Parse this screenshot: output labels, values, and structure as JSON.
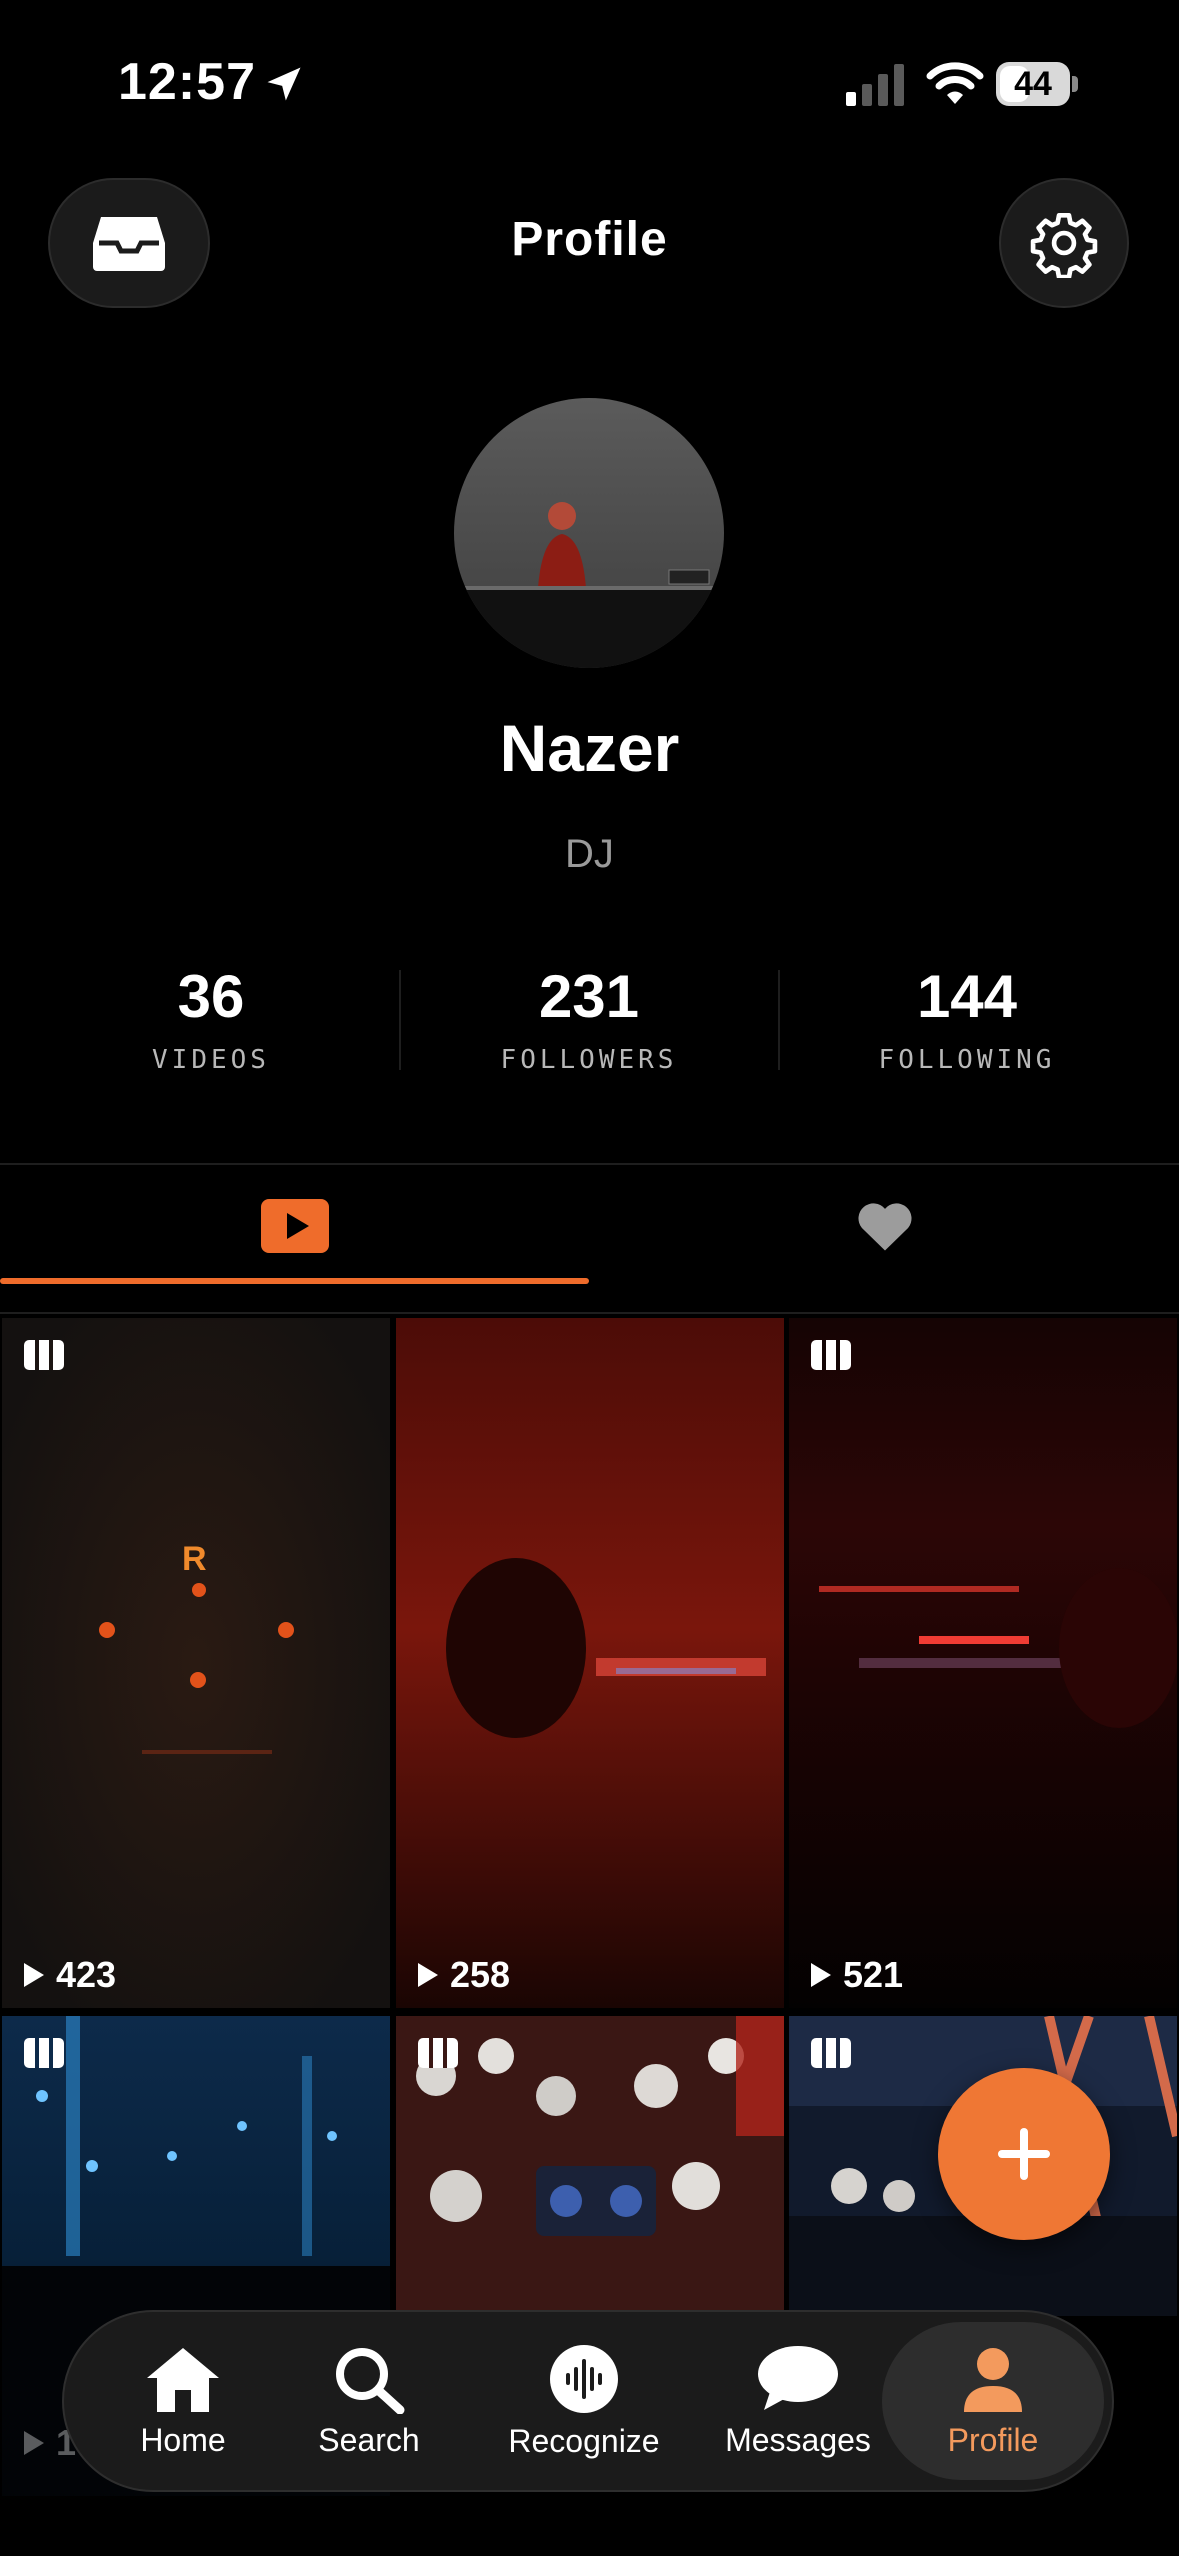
{
  "status_bar": {
    "time": "12:57",
    "battery": "44",
    "battery_level": 0.44
  },
  "header": {
    "title": "Profile"
  },
  "profile": {
    "name": "Nazer",
    "role": "DJ",
    "stats": [
      {
        "value": "36",
        "label": "VIDEOS"
      },
      {
        "value": "231",
        "label": "FOLLOWERS"
      },
      {
        "value": "144",
        "label": "FOLLOWING"
      }
    ]
  },
  "tabs": [
    {
      "icon": "video-play-icon",
      "active": true
    },
    {
      "icon": "heart-icon",
      "active": false
    }
  ],
  "videos": [
    {
      "plays": "423",
      "multi": true
    },
    {
      "plays": "258",
      "multi": false
    },
    {
      "plays": "521",
      "multi": true
    },
    {
      "plays": "1",
      "multi": true
    },
    {
      "plays": "",
      "multi": true
    },
    {
      "plays": "",
      "multi": true
    }
  ],
  "colors": {
    "accent": "#EF7734",
    "background": "#000000"
  },
  "nav": {
    "items": [
      {
        "label": "Home",
        "icon": "home-icon"
      },
      {
        "label": "Search",
        "icon": "search-icon"
      },
      {
        "label": "Recognize",
        "icon": "waveform-icon"
      },
      {
        "label": "Messages",
        "icon": "chat-bubble-icon"
      },
      {
        "label": "Profile",
        "icon": "person-icon",
        "active": true
      }
    ]
  }
}
